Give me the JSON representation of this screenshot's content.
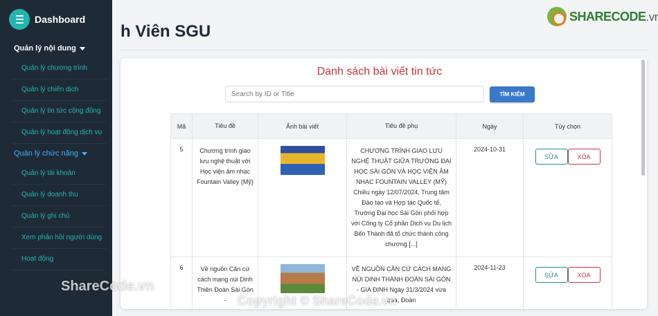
{
  "sidebar": {
    "brand": "Dashboard",
    "group1": "Quản lý nội dung",
    "group1_items": [
      "Quản lý chương trình",
      "Quản lý chiến dịch",
      "Quản lý tin tức cộng đồng",
      "Quản lý hoạt động dịch vụ"
    ],
    "group2": "Quản lý chức năng",
    "group2_items": [
      "Quản lý tài khoản",
      "Quản lý doanh thu",
      "Quản lý ghi chú",
      "Xem phản hồi người dùng",
      "Hoạt động"
    ]
  },
  "header": {
    "title": "h Viên SGU"
  },
  "logo": {
    "main": "SHARECODE",
    "tail": ".vn"
  },
  "main": {
    "title": "Danh sách bài viết tin tức",
    "search_placeholder": "Search by ID or Title",
    "search_button": "TÌM KIẾM",
    "columns": [
      "Mã",
      "Tiêu đề",
      "Ảnh bài viết",
      "Tiêu đề phụ",
      "Ngày",
      "Tùy chọn"
    ],
    "rows": [
      {
        "id": "5",
        "title": "Chương trình giao lưu nghệ thuật với Học viện âm nhạc Fountain Valley (Mỹ)",
        "subtitle": "CHƯƠNG TRÌNH GIAO LƯU NGHỆ THUẬT GIỮA TRƯỜNG ĐẠI HỌC SÀI GÒN VÀ HỌC VIỆN ÂM NHẠC FOUNTAIN VALLEY (MỸ) Chiều ngày 12/07/2024, Trung tâm Đào tạo và Hợp tác Quốc tế, Trường Đại học Sài Gòn phối hợp với Công ty Cổ phần Dịch vụ Du lịch Bến Thành đã tổ chức thành công chương [...]",
        "date": "2024-10-31",
        "edit": "SỬA",
        "delete": "XÓA"
      },
      {
        "id": "6",
        "title": "Về nguồn Căn cứ cách mạng núi Dinh Thiên Đoàn Sài Gòn -",
        "subtitle": "VỀ NGUỒN CĂN CỨ CÁCH MẠNG NÚI DINH THÀNH ĐOÀN SÀI GÒN - GIA ĐỊNH Ngày 31/3/2024 vừa qua, Đoàn",
        "date": "2024-11-23",
        "edit": "SỬA",
        "delete": "XÓA"
      }
    ]
  },
  "watermarks": {
    "left": "ShareCode.vn",
    "center": "Copyright © ShareCode.vn"
  },
  "colors": {
    "sidebar_bg": "#1f2a37",
    "accent_teal": "#21b7b0",
    "title_red": "#c6353c",
    "button_blue": "#3a78c9"
  }
}
